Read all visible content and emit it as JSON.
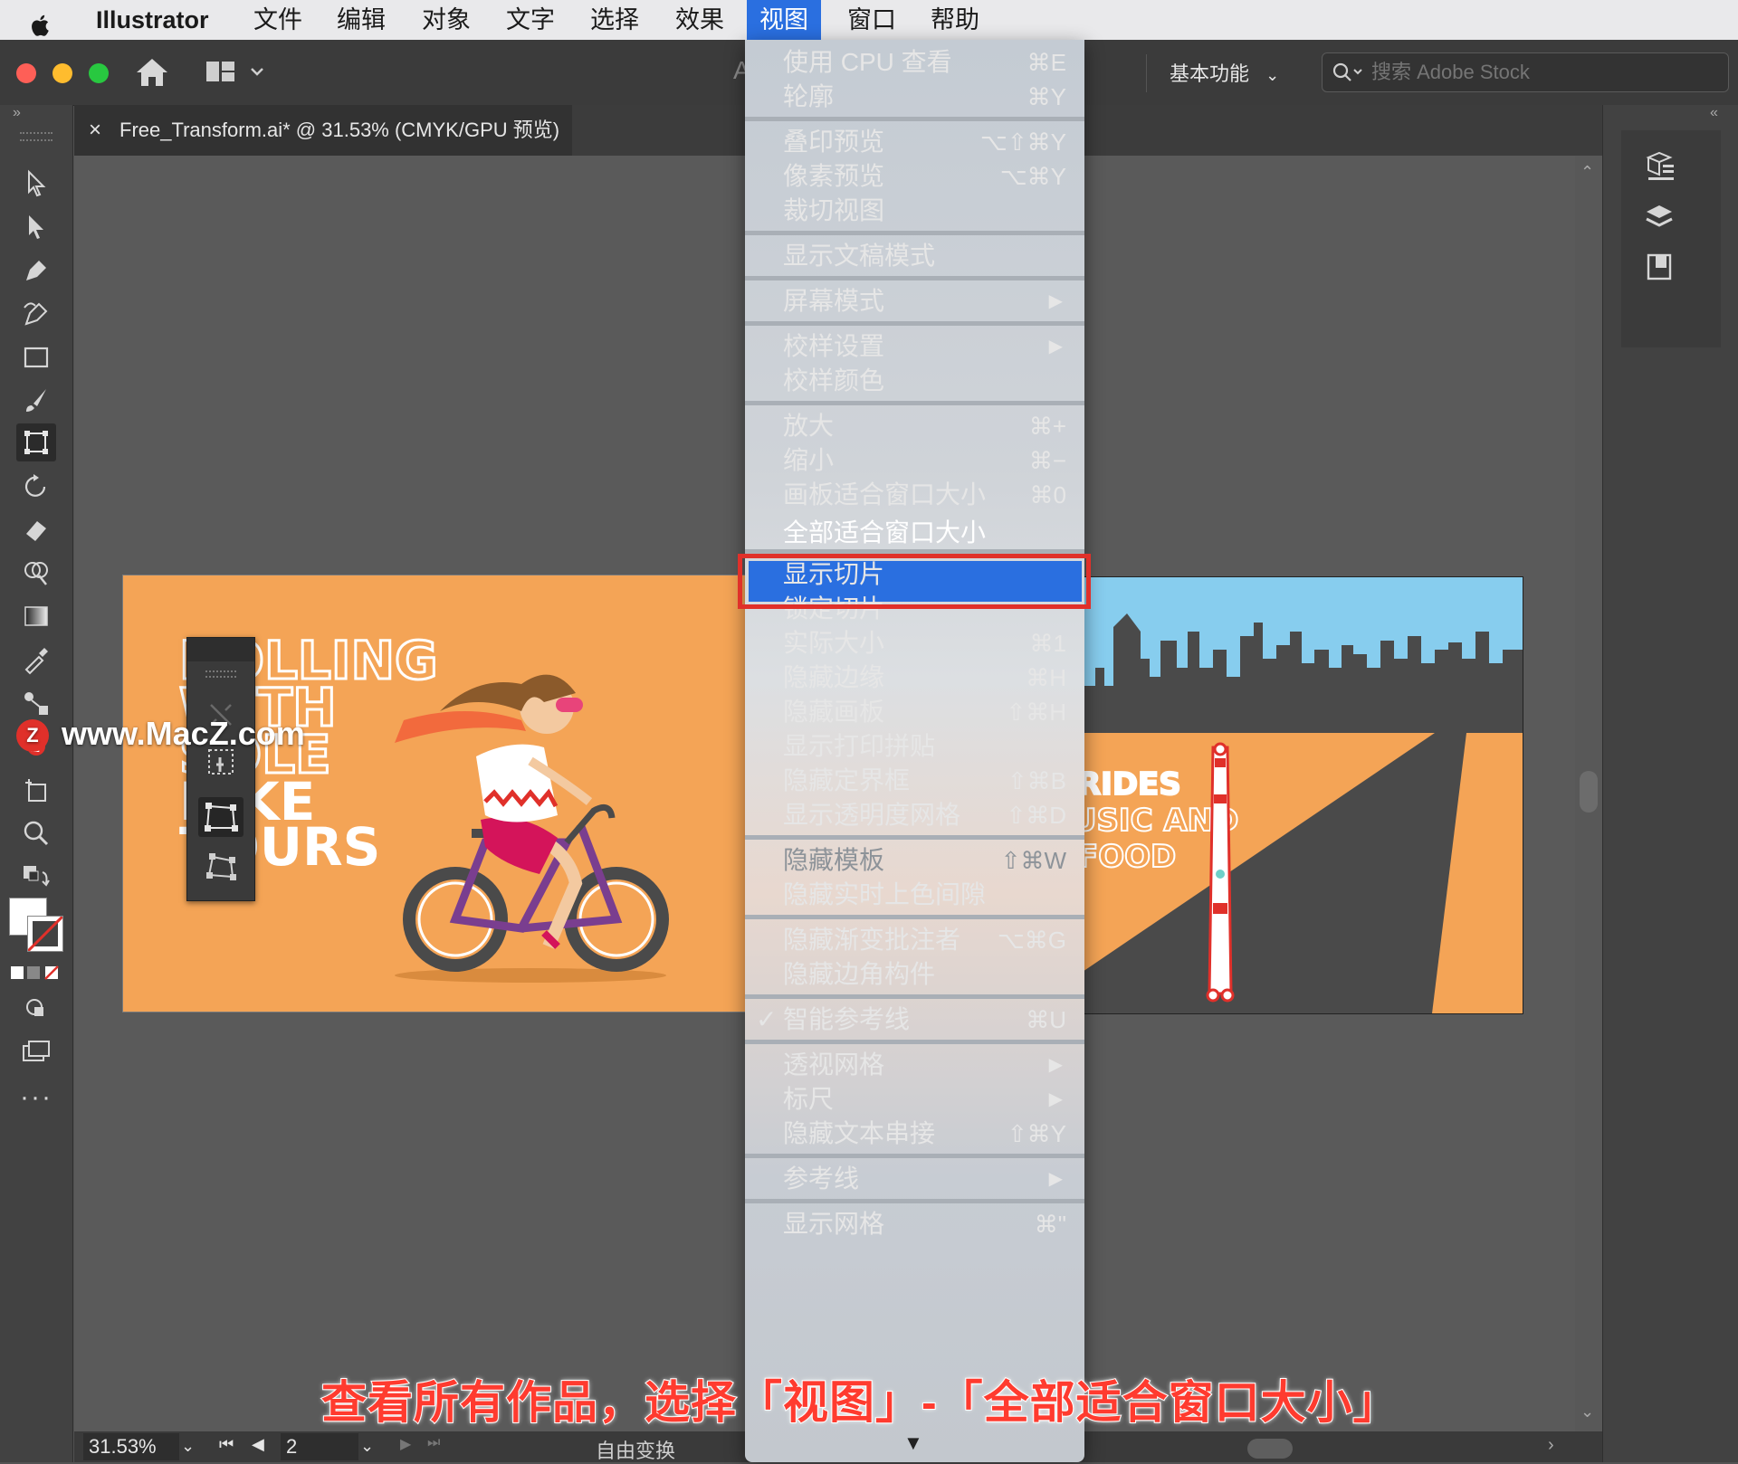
{
  "menubar": {
    "app_name": "Illustrator",
    "items": [
      "文件",
      "编辑",
      "对象",
      "文字",
      "选择",
      "效果",
      "视图",
      "窗口",
      "帮助"
    ],
    "active": "视图"
  },
  "appbar": {
    "workspace": "基本功能",
    "search_placeholder": "搜索 Adobe Stock",
    "partial_text": "A"
  },
  "document": {
    "tab_title": "Free_Transform.ai* @ 31.53% (CMYK/GPU 预览)",
    "close_glyph": "×"
  },
  "status": {
    "zoom": "31.53%",
    "artboard": "2",
    "tool_name": "自由变换"
  },
  "view_menu": {
    "items": [
      {
        "label": "使用 CPU 查看",
        "shortcut": "⌘E"
      },
      {
        "label": "轮廓",
        "shortcut": "⌘Y"
      },
      {
        "sep": true
      },
      {
        "label": "叠印预览",
        "shortcut": "⌥⇧⌘Y"
      },
      {
        "label": "像素预览",
        "shortcut": "⌥⌘Y"
      },
      {
        "label": "裁切视图",
        "shortcut": ""
      },
      {
        "sep": true
      },
      {
        "label": "显示文稿模式",
        "shortcut": ""
      },
      {
        "sep": true
      },
      {
        "label": "屏幕模式",
        "submenu": true
      },
      {
        "sep": true
      },
      {
        "label": "校样设置",
        "submenu": true
      },
      {
        "label": "校样颜色",
        "shortcut": ""
      },
      {
        "sep": true
      },
      {
        "label": "放大",
        "shortcut": "⌘+"
      },
      {
        "label": "缩小",
        "shortcut": "⌘−"
      },
      {
        "label": "画板适合窗口大小",
        "shortcut": "⌘0"
      },
      {
        "label": "全部适合窗口大小",
        "shortcut": "",
        "highlighted": true
      },
      {
        "sep": true
      },
      {
        "label": "显示切片",
        "shortcut": ""
      },
      {
        "label": "锁定切片",
        "shortcut": ""
      },
      {
        "label": "实际大小",
        "shortcut": "⌘1"
      },
      {
        "label": "隐藏边缘",
        "shortcut": "⌘H"
      },
      {
        "label": "隐藏画板",
        "shortcut": "⇧⌘H"
      },
      {
        "label": "显示打印拼贴",
        "shortcut": ""
      },
      {
        "label": "隐藏定界框",
        "shortcut": "⇧⌘B"
      },
      {
        "label": "显示透明度网格",
        "shortcut": "⇧⌘D"
      },
      {
        "sep": true
      },
      {
        "label": "隐藏模板",
        "shortcut": "⇧⌘W",
        "disabled": true
      },
      {
        "label": "隐藏实时上色间隙",
        "shortcut": ""
      },
      {
        "sep": true
      },
      {
        "label": "隐藏渐变批注者",
        "shortcut": "⌥⌘G"
      },
      {
        "label": "隐藏边角构件",
        "shortcut": ""
      },
      {
        "sep": true
      },
      {
        "label": "智能参考线",
        "shortcut": "⌘U",
        "checked": true
      },
      {
        "sep": true
      },
      {
        "label": "透视网格",
        "submenu": true
      },
      {
        "label": "标尺",
        "submenu": true
      },
      {
        "label": "隐藏文本串接",
        "shortcut": "⇧⌘Y"
      },
      {
        "sep": true
      },
      {
        "label": "参考线",
        "submenu": true
      },
      {
        "sep": true
      },
      {
        "label": "显示网格",
        "shortcut": "⌘\""
      }
    ],
    "checkmark": "✓",
    "submenu_arrow": "▶",
    "scroll_arrow": "▼"
  },
  "artwork": {
    "left_title_lines": [
      "ROLLING",
      "WITH",
      "SOLE",
      "BIKE",
      "TOURS"
    ],
    "right_text_lines": [
      "RIDES",
      "MUSIC AND",
      "FOOD"
    ]
  },
  "watermark": "www.MacZ.com",
  "caption": "查看所有作品，选择「视图」-「全部适合窗口大小」",
  "colors": {
    "menu_highlight": "#2a6fe0",
    "highlight_box": "#e0302a",
    "artboard_orange": "#f4a456",
    "sky_blue": "#87cdee",
    "city_gray": "#4a4a4a"
  }
}
